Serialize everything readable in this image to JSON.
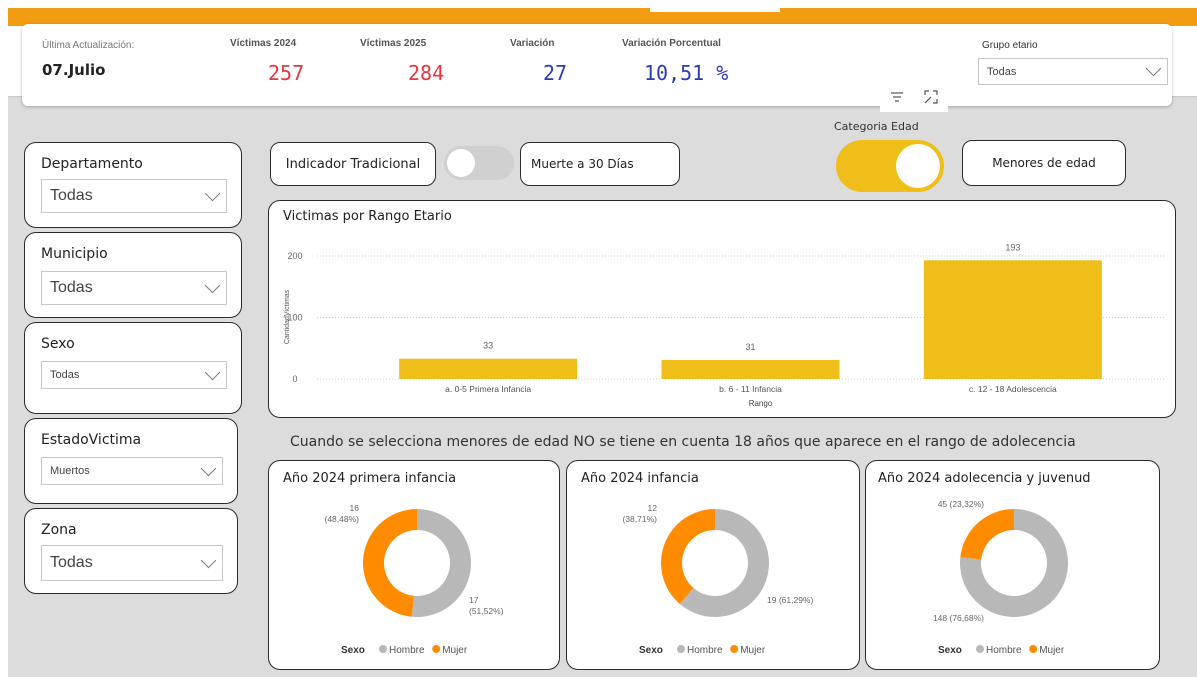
{
  "header": {
    "last_update_label": "Última Actualización:",
    "last_update_value": "07.Julio",
    "kpis": [
      {
        "label": "Víctimas 2024",
        "value": "257",
        "color": "#e8353f"
      },
      {
        "label": "Víctimas 2025",
        "value": "284",
        "color": "#e8353f"
      },
      {
        "label": "Variación",
        "value": "27",
        "color": "#2a3bb8"
      },
      {
        "label": "Variación Porcentual",
        "value": "10,51 %",
        "color": "#2a3bb8"
      }
    ],
    "age_group_label": "Grupo etario",
    "age_group_value": "Todas"
  },
  "slicers": [
    {
      "title": "Departamento",
      "value": "Todas"
    },
    {
      "title": "Municipio",
      "value": "Todas"
    },
    {
      "title": "Sexo",
      "value": "Todas"
    },
    {
      "title": "EstadoVictima",
      "value": "Muertos"
    },
    {
      "title": "Zona",
      "value": "Todas"
    }
  ],
  "toggles": {
    "indicator_label": "Indicador Tradicional",
    "death30_label": "Muerte a 30 Días",
    "category_label": "Categoria Edad",
    "minors_label": "Menores de edad"
  },
  "note": "Cuando se selecciona menores de edad NO se tiene en cuenta 18 años que aparece en el rango de adolecencia",
  "colors": {
    "accent": "#f39c11",
    "bar": "#f0be18",
    "hombre": "#b8b8b8",
    "mujer": "#ff8c00"
  },
  "chart_data": [
    {
      "type": "bar",
      "title": "Victimas por Rango Etario",
      "xlabel": "Rango",
      "ylabel": "CantidadVictimas",
      "ylim": [
        0,
        200
      ],
      "yticks": [
        "0",
        "100",
        "200"
      ],
      "categories": [
        "a. 0-5 Primera Infancia",
        "b. 6 - 11 Infancia",
        "c. 12 - 18 Adolescencia"
      ],
      "values": [
        33,
        31,
        193
      ],
      "grid": true
    },
    {
      "type": "pie",
      "title": "Año 2024 primera infancia",
      "labels": [
        "Hombre",
        "Mujer"
      ],
      "values": [
        17,
        16
      ],
      "data_labels": [
        "17\n(51,52%)",
        "16\n(48,48%)"
      ],
      "legend_title": "Sexo"
    },
    {
      "type": "pie",
      "title": "Año 2024 infancia",
      "labels": [
        "Hombre",
        "Mujer"
      ],
      "values": [
        19,
        12
      ],
      "data_labels": [
        "19 (61,29%)",
        "12\n(38,71%)"
      ],
      "legend_title": "Sexo"
    },
    {
      "type": "pie",
      "title": "Año 2024 adolecencia y juvenud",
      "labels": [
        "Hombre",
        "Mujer"
      ],
      "values": [
        148,
        45
      ],
      "data_labels": [
        "148 (76,68%)",
        "45 (23,32%)"
      ],
      "legend_title": "Sexo"
    }
  ]
}
